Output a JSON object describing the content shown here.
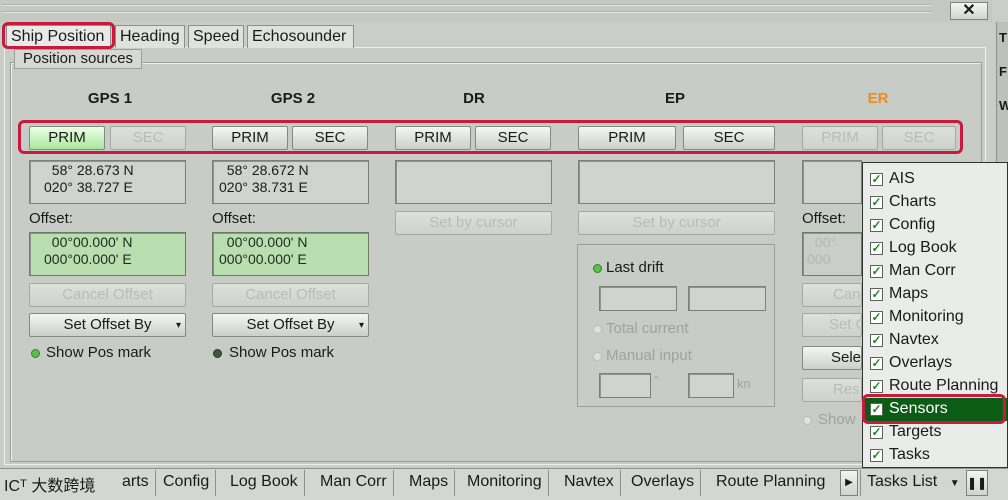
{
  "window": {
    "close_glyph": "✕"
  },
  "side_strip_letters": [
    "T",
    "F",
    "W"
  ],
  "tabs": [
    {
      "label": "Ship Position",
      "active": true
    },
    {
      "label": "Heading"
    },
    {
      "label": "Speed"
    },
    {
      "label": "Echosounder"
    }
  ],
  "group_title": "Position sources",
  "columns": [
    {
      "title": "GPS 1",
      "title_color": "#1a1a1a",
      "prim": "PRIM",
      "sec": "SEC",
      "coord_lines": "  58° 28.673 N\n020° 38.727 E",
      "offset_label": "Offset:",
      "offset_value": "  00°00.000' N\n000°00.000' E",
      "cancel_offset": "Cancel Offset",
      "set_offset_by": "Set Offset By",
      "show_pos_mark": "Show Pos mark"
    },
    {
      "title": "GPS 2",
      "title_color": "#1a1a1a",
      "prim": "PRIM",
      "sec": "SEC",
      "coord_lines": "  58° 28.672 N\n020° 38.731 E",
      "offset_label": "Offset:",
      "offset_value": "  00°00.000' N\n000°00.000' E",
      "cancel_offset": "Cancel Offset",
      "set_offset_by": "Set Offset By",
      "show_pos_mark": "Show Pos mark"
    },
    {
      "title": "DR",
      "title_color": "#1a1a1a",
      "prim": "PRIM",
      "sec": "SEC",
      "set_by_cursor": "Set by cursor"
    },
    {
      "title": "EP",
      "title_color": "#1a1a1a",
      "prim": "PRIM",
      "sec": "SEC",
      "set_by_cursor": "Set by cursor",
      "last_drift": "Last drift",
      "total_current": "Total current",
      "manual_input": "Manual input",
      "degree_unit": "°",
      "speed_unit": "kn"
    },
    {
      "title": "ER",
      "title_color": "#f08a1c",
      "prim": "PRIM",
      "sec": "SEC",
      "offset_label": "Offset:",
      "offset_value_partial": "  00°\n000",
      "cancel_partial": "Can",
      "set_partial": "Set O",
      "select_partial": "Sele",
      "reset_partial": "Res",
      "show_partial": "Show"
    }
  ],
  "popup_menu": [
    {
      "label": "AIS",
      "checked": true
    },
    {
      "label": "Charts",
      "checked": true
    },
    {
      "label": "Config",
      "checked": true
    },
    {
      "label": "Log Book",
      "checked": true
    },
    {
      "label": "Man Corr",
      "checked": true
    },
    {
      "label": "Maps",
      "checked": true
    },
    {
      "label": "Monitoring",
      "checked": true
    },
    {
      "label": "Navtex",
      "checked": true
    },
    {
      "label": "Overlays",
      "checked": true
    },
    {
      "label": "Route Planning",
      "checked": true
    },
    {
      "label": "Sensors",
      "checked": true,
      "selected": true
    },
    {
      "label": "Targets",
      "checked": true
    },
    {
      "label": "Tasks",
      "checked": true
    }
  ],
  "taskbar": {
    "watermark": "ICᵀ 大数跨境",
    "items": [
      "arts",
      "Config",
      "Log Book",
      "Man Corr",
      "Maps",
      "Monitoring",
      "Navtex",
      "Overlays",
      "Route Planning"
    ],
    "scroll_right_glyph": "▶",
    "tasks_list": "Tasks List",
    "tasks_list_arrow": "▼",
    "end_glyph": "❚❚"
  },
  "colors": {
    "accent_outline": "#c71a3c",
    "prim_active": "#a9e69a",
    "selected_item": "#0c5c16",
    "er_title": "#f08a1c"
  }
}
